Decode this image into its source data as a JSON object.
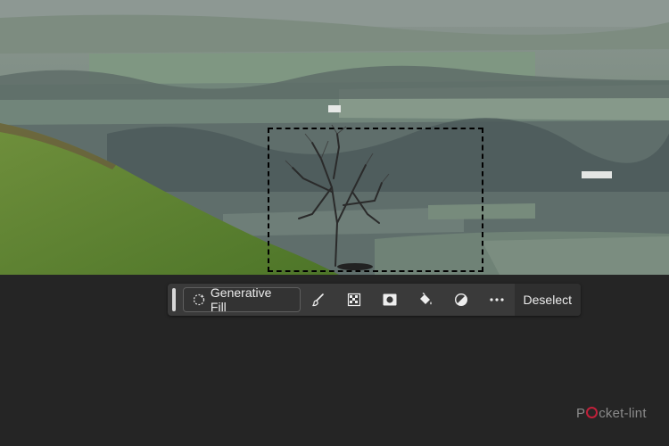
{
  "toolbar": {
    "generative_fill_label": "Generative Fill",
    "deselect_label": "Deselect",
    "tools": [
      {
        "name": "brush-tool"
      },
      {
        "name": "transparency-grid-tool"
      },
      {
        "name": "mask-tool"
      },
      {
        "name": "paint-bucket-tool"
      },
      {
        "name": "adjustment-tool"
      },
      {
        "name": "more-options"
      }
    ]
  },
  "watermark": {
    "text": "Pocket-lint"
  },
  "colors": {
    "canvas_bg": "#252525",
    "toolbar_bg": "#3a3a3a",
    "text": "#ececec",
    "logo_accent": "#c0203a"
  }
}
